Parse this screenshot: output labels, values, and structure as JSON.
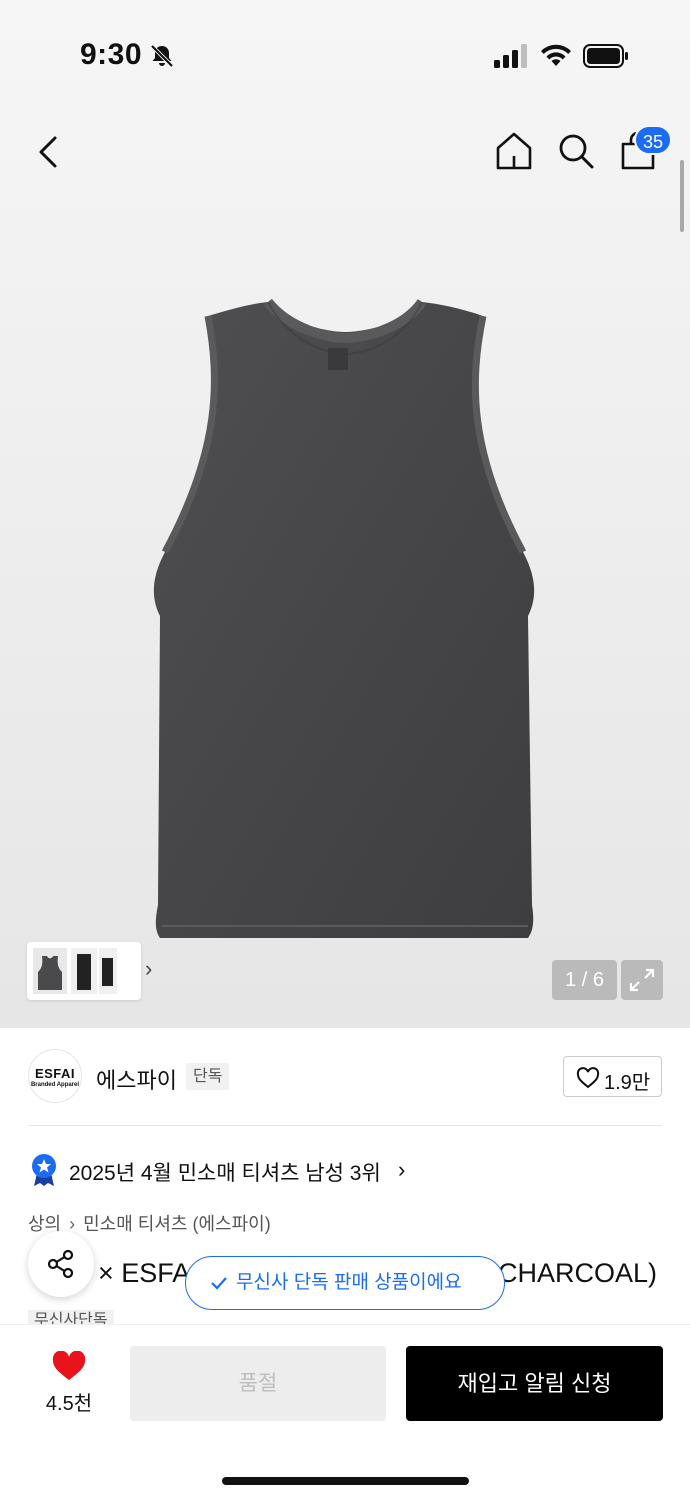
{
  "status": {
    "time": "9:30"
  },
  "header": {
    "cart_count": "35"
  },
  "gallery": {
    "page_indicator": "1 / 6"
  },
  "brand": {
    "logo_main": "ESFAI",
    "logo_sub": "Branded Apparel",
    "name": "에스파이",
    "exclusive_tag": "단독",
    "like_count": "1.9만"
  },
  "ranking": {
    "text": "2025년 4월 민소매 티셔츠 남성 3위"
  },
  "breadcrumb": {
    "level1": "상의",
    "level2": "민소매 티셔츠 (에스파이)"
  },
  "product": {
    "title_left": "× ESFA",
    "title_right": "CHARCOAL)",
    "badge": "무신사단독"
  },
  "toast": {
    "text": "무신사 단독 판매 상품이에요"
  },
  "bottom": {
    "wish_count": "4.5천",
    "soldout_label": "품절",
    "restock_label": "재입고 알림 신청"
  },
  "colors": {
    "accent_blue": "#1b6cf2",
    "heart_red": "#e8131b",
    "product_charcoal": "#4a4a4c"
  }
}
